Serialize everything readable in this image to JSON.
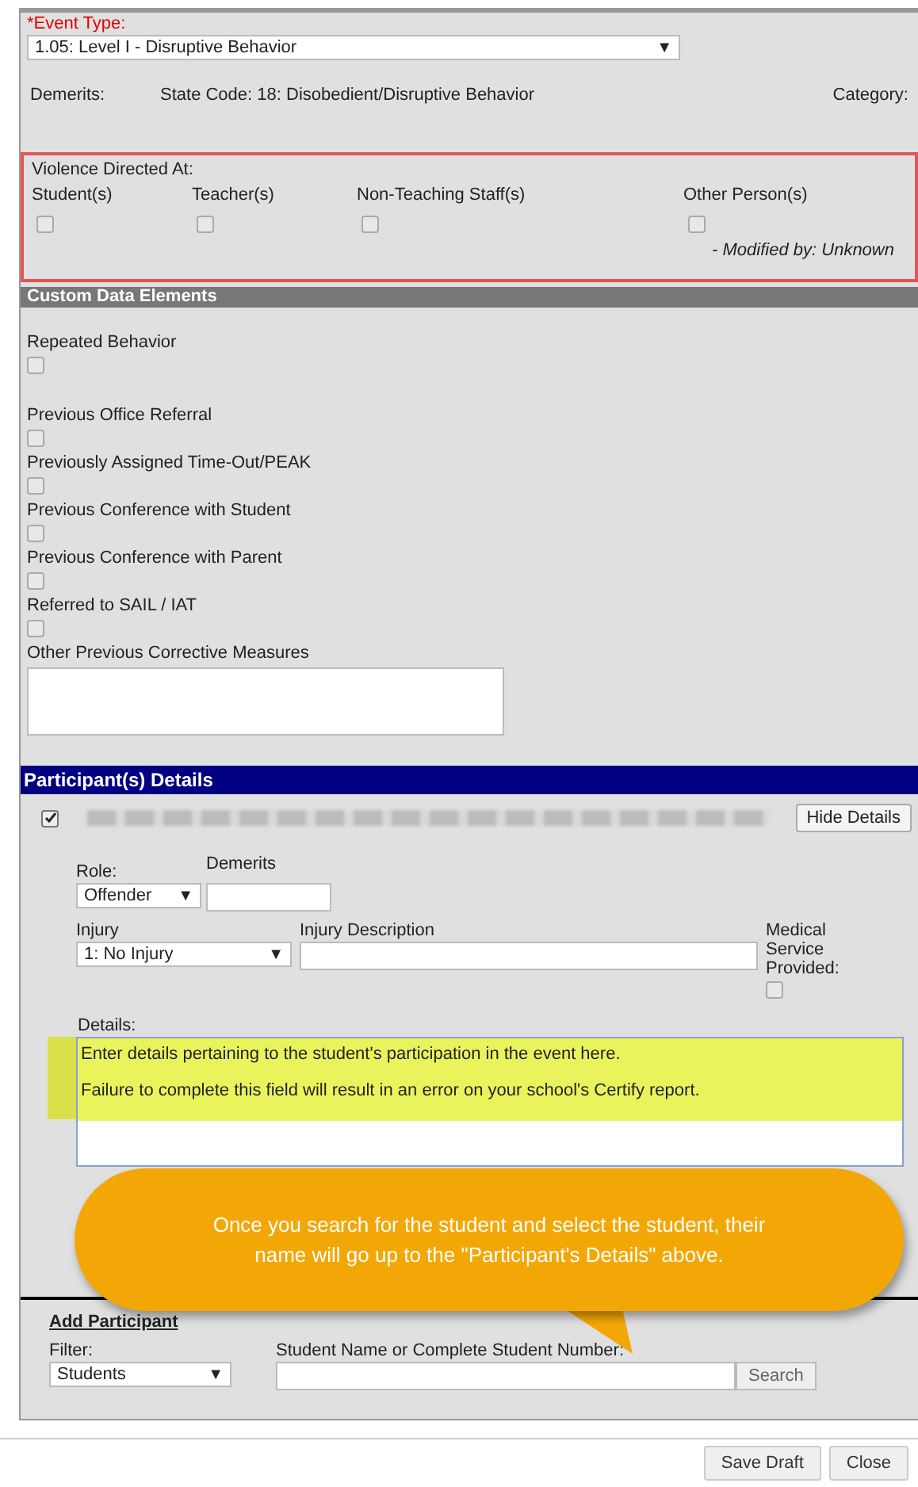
{
  "event_type": {
    "label": "*Event Type:",
    "value": "1.05: Level I - Disruptive Behavior"
  },
  "info": {
    "demerits": "Demerits:",
    "state_code": "State Code: 18: Disobedient/Disruptive Behavior",
    "category": "Category:"
  },
  "violence": {
    "title": "Violence Directed At:",
    "options": [
      {
        "label": "Student(s)",
        "checked": false
      },
      {
        "label": "Teacher(s)",
        "checked": false
      },
      {
        "label": "Non-Teaching Staff(s)",
        "checked": false
      },
      {
        "label": "Other Person(s)",
        "checked": false
      }
    ],
    "modified": "- Modified by: Unknown"
  },
  "custom": {
    "title": "Custom Data Elements",
    "items": [
      {
        "kind": "checkbox",
        "label": "Repeated Behavior",
        "checked": false
      },
      {
        "kind": "checkbox",
        "label": "Previous Office Referral",
        "checked": false
      },
      {
        "kind": "checkbox",
        "label": "Previously Assigned Time-Out/PEAK",
        "checked": false
      },
      {
        "kind": "checkbox",
        "label": "Previous Conference with Student",
        "checked": false
      },
      {
        "kind": "checkbox",
        "label": "Previous Conference with Parent",
        "checked": false
      },
      {
        "kind": "checkbox",
        "label": "Referred to SAIL / IAT",
        "checked": false
      },
      {
        "kind": "textarea",
        "label": "Other Previous Corrective Measures"
      }
    ]
  },
  "participants": {
    "title": "Participant(s) Details",
    "checked": true,
    "hide_button": "Hide Details",
    "role": {
      "label": "Role:",
      "value": "Offender"
    },
    "demerits": {
      "label": "Demerits"
    },
    "injury": {
      "label": "Injury",
      "value": "1: No Injury"
    },
    "injury_description": {
      "label": "Injury Description"
    },
    "medical": {
      "label": "Medical Service Provided:",
      "checked": false
    },
    "details": {
      "label": "Details:",
      "lines": [
        "Enter details pertaining to the student's participation in the event here.",
        "Failure to complete this field will result in an error on your school's Certify report."
      ]
    }
  },
  "callout": "Once you search for the student and select the student, their name will go up to the \"Participant's Details\" above.",
  "add_participant": {
    "title": "Add Participant",
    "filter_label": "Filter:",
    "filter_value": "Students",
    "search_label": "Student Name or Complete Student Number:",
    "search_button": "Search"
  },
  "footer": {
    "buttons": [
      "Save Draft",
      "Close"
    ]
  },
  "dropdown_glyph": "▼"
}
